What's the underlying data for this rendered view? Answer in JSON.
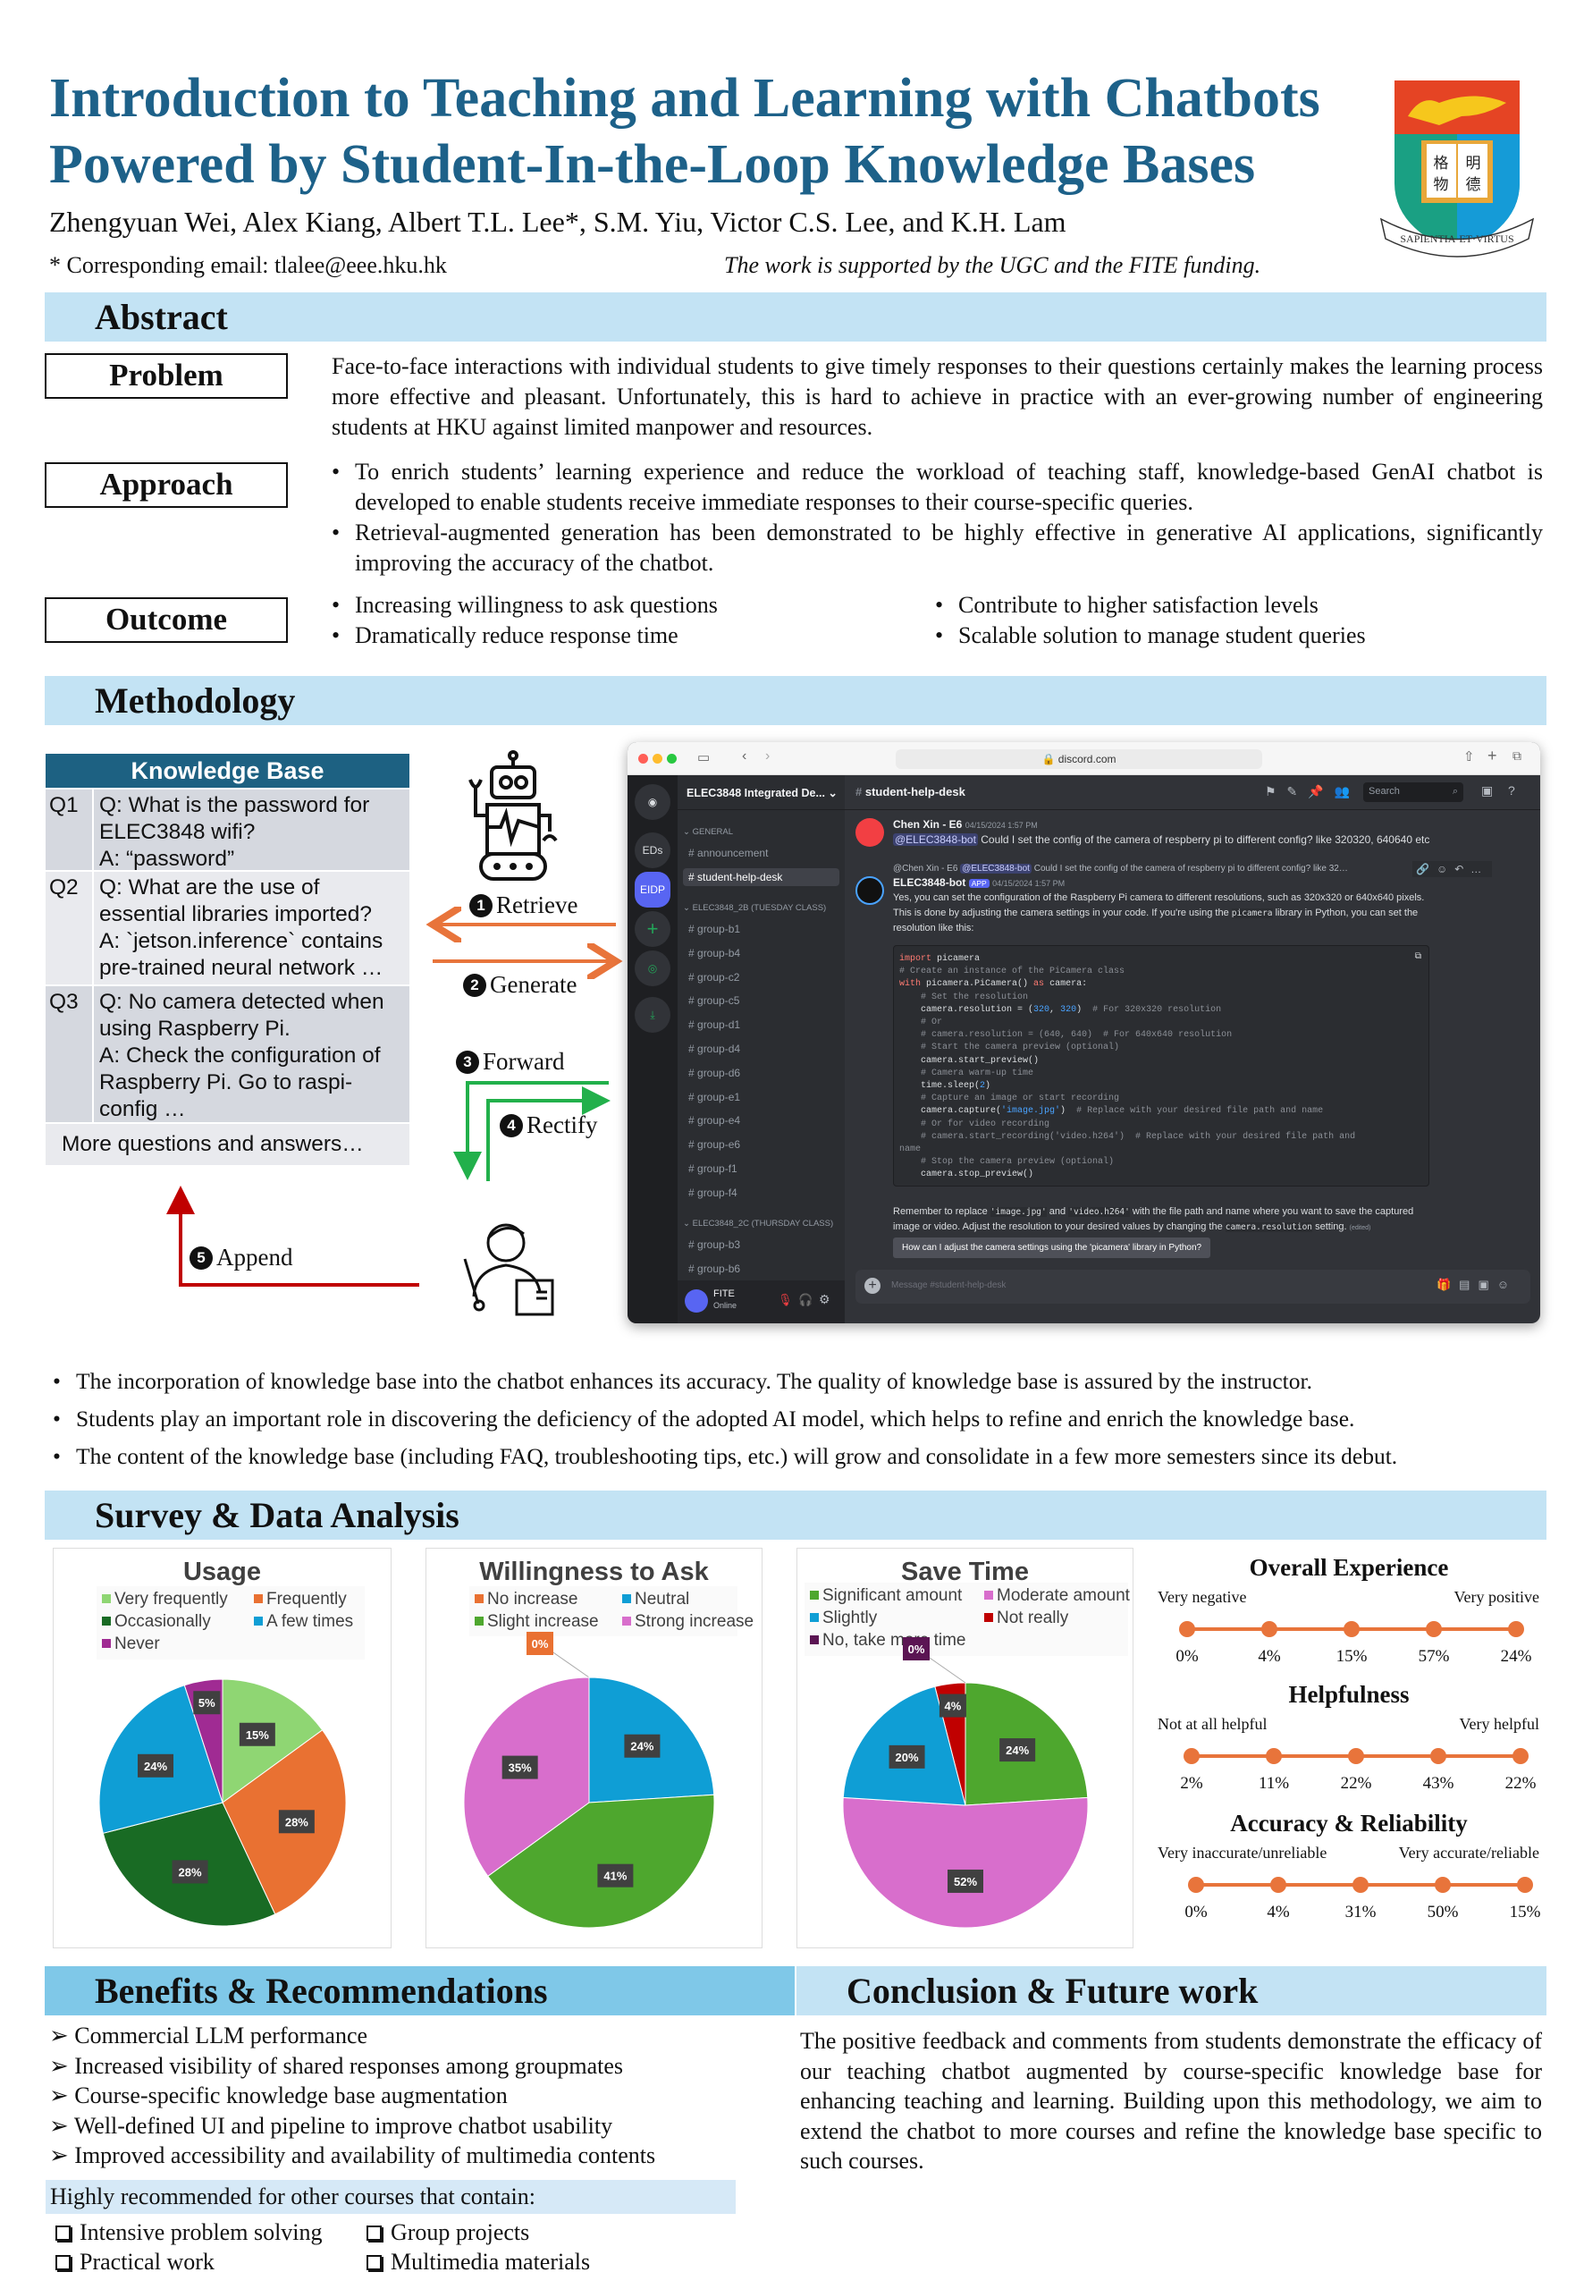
{
  "header": {
    "title_line1": "Introduction to Teaching and Learning with Chatbots",
    "title_line2": "Powered by Student-In-the-Loop Knowledge Bases",
    "authors": "Zhengyuan Wei, Alex Kiang, Albert T.L. Lee*, S.M. Yiu, Victor C.S. Lee, and K.H. Lam",
    "email": "* Corresponding email: tlalee@eee.hku.hk",
    "funding": "The work is supported by the UGC and the FITE funding.",
    "logo": {
      "motto": "SAPIENTIA · ET · VIRTUS",
      "characters": "格物明德"
    }
  },
  "colors": {
    "title": "#1d6189",
    "band": "#c3e3f4",
    "band_dark": "#7fc8e8",
    "kb_header": "#1d6182",
    "scale": "#e8743b"
  },
  "abstract": {
    "heading": "Abstract",
    "problem": {
      "label": "Problem",
      "text": "Face-to-face interactions with individual students to give timely responses to their questions certainly makes the learning process more effective and pleasant. Unfortunately, this is hard to achieve in practice with an ever-growing number of engineering students at HKU against limited manpower and resources."
    },
    "approach": {
      "label": "Approach",
      "bullets": [
        "To enrich students’ learning experience and reduce the workload of teaching staff, knowledge-based GenAI chatbot is developed to enable students receive immediate responses to their course-specific queries.",
        "Retrieval-augmented generation has been demonstrated to be highly effective in generative AI applications, significantly improving the accuracy of the chatbot."
      ]
    },
    "outcome": {
      "label": "Outcome",
      "bullets": [
        "Increasing willingness to ask questions",
        "Dramatically reduce response time",
        "Contribute to higher satisfaction levels",
        "Scalable solution to manage student queries"
      ]
    }
  },
  "methodology": {
    "heading": "Methodology",
    "knowledge_base": {
      "title": "Knowledge Base",
      "rows": [
        {
          "id": "Q1",
          "text": "Q: What is the password for ELEC3848 wifi?\nA: “password”"
        },
        {
          "id": "Q2",
          "text": "Q: What are the use of essential libraries imported?\nA: `jetson.inference` contains pre-trained neural network …"
        },
        {
          "id": "Q3",
          "text": "Q: No camera detected when using Raspberry Pi.\nA: Check the configuration of Raspberry Pi. Go to raspi-config …"
        }
      ],
      "more": "More questions and answers…"
    },
    "steps": [
      {
        "n": "1",
        "label": "Retrieve"
      },
      {
        "n": "2",
        "label": "Generate"
      },
      {
        "n": "3",
        "label": "Forward"
      },
      {
        "n": "4",
        "label": "Rectify"
      },
      {
        "n": "5",
        "label": "Append"
      }
    ],
    "bullets": [
      "The incorporation of knowledge base into the chatbot enhances its accuracy. The quality of knowledge base is assured by the instructor.",
      "Students play an important role in discovering the deficiency of the adopted AI model, which helps to refine and enrich the knowledge base.",
      "The content of the knowledge base (including FAQ, troubleshooting tips, etc.) will grow and consolidate in a few more semesters since its debut."
    ]
  },
  "discord": {
    "url": "discord.com",
    "server_name": "ELEC3848 Integrated De...",
    "servers": [
      "EDs",
      "EIDP"
    ],
    "channel": "student-help-desk",
    "search_placeholder": "Search",
    "categories": [
      "GENERAL",
      "ELEC3848_2B (TUESDAY CLASS)",
      "ELEC3848_2C (THURSDAY CLASS)"
    ],
    "general_channels": [
      "announcement",
      "student-help-desk"
    ],
    "tuesday_channels": [
      "group-b1",
      "group-b4",
      "group-c2",
      "group-c5",
      "group-d1",
      "group-d4",
      "group-d6",
      "group-e1",
      "group-e4",
      "group-e6",
      "group-f1",
      "group-f4"
    ],
    "thursday_channels": [
      "group-b3",
      "group-b6"
    ],
    "user": {
      "name": "FITE",
      "status": "Online"
    },
    "messages": [
      {
        "author": "Chen Xin - E6",
        "time": "04/15/2024 1:57 PM",
        "mention": "@ELEC3848-bot",
        "text": " Could I set the config of the camera of respberry pi to different config? like 320320, 640640 etc"
      },
      {
        "reply_to": "@Chen Xin - E6",
        "reply_mention": "@ELEC3848-bot",
        "reply_text": " Could I set the config of the camera of respberry pi to different config? like 32…",
        "author": "ELEC3848-bot",
        "badge": "APP",
        "time": "04/15/2024 1:57 PM",
        "text1": "Yes, you can set the configuration of the Raspberry Pi camera to different resolutions, such as 320x320 or 640x640 pixels.",
        "text2a": "This is done by adjusting the camera settings in your code. If you're using the ",
        "code_inline": "picamera",
        "text2b": " library in Python, you can set the",
        "text3": "resolution like this:",
        "after1a": "Remember to replace ",
        "after_c1": "'image.jpg'",
        "after1b": " and ",
        "after_c2": "'video.h264'",
        "after1c": " with the file path and name where you want to save the captured",
        "after2a": "image or video. Adjust the resolution to your desired values by changing the ",
        "after_c3": "camera.resolution",
        "after2b": " setting.",
        "edited": "(edited)",
        "suggestion": "How can I adjust the camera settings using the 'picamera' library in Python?"
      }
    ],
    "input_placeholder": "Message #student-help-desk"
  },
  "survey": {
    "heading": "Survey & Data Analysis"
  },
  "chart_data": [
    {
      "type": "pie",
      "title": "Usage",
      "categories": [
        "Very frequently",
        "Frequently",
        "Occasionally",
        "A few times",
        "Never"
      ],
      "values": [
        15,
        28,
        28,
        24,
        5
      ],
      "colors": [
        "#8fd673",
        "#e97132",
        "#196b24",
        "#0f9ed5",
        "#a02b93"
      ],
      "legend": "top"
    },
    {
      "type": "pie",
      "title": "Willingness to Ask",
      "categories": [
        "No increase",
        "Neutral",
        "Slight increase",
        "Strong increase"
      ],
      "values": [
        0,
        24,
        41,
        35
      ],
      "colors": [
        "#e97132",
        "#0f9ed5",
        "#4ea72e",
        "#d86ecc"
      ],
      "legend": "top"
    },
    {
      "type": "pie",
      "title": "Save Time",
      "categories": [
        "Significant amount",
        "Moderate amount",
        "Slightly",
        "Not really",
        "No, take more time"
      ],
      "values": [
        24,
        52,
        20,
        4,
        0
      ],
      "colors": [
        "#4ea72e",
        "#d86ecc",
        "#0f9ed5",
        "#c00000",
        "#5b1553"
      ],
      "legend": "top"
    },
    {
      "type": "scale",
      "title": "Overall Experience",
      "low_label": "Very negative",
      "high_label": "Very positive",
      "values": [
        0,
        4,
        15,
        57,
        24
      ]
    },
    {
      "type": "scale",
      "title": "Helpfulness",
      "low_label": "Not at all helpful",
      "high_label": "Very helpful",
      "values": [
        2,
        11,
        22,
        43,
        22
      ]
    },
    {
      "type": "scale",
      "title": "Accuracy & Reliability",
      "low_label": "Very inaccurate/unreliable",
      "high_label": "Very accurate/reliable",
      "values": [
        0,
        4,
        31,
        50,
        15
      ]
    }
  ],
  "benefits": {
    "heading": "Benefits & Recommendations",
    "items": [
      "Commercial LLM performance",
      "Increased visibility of shared responses among groupmates",
      "Course-specific knowledge base augmentation",
      "Well-defined UI and pipeline to improve chatbot usability",
      "Improved accessibility and availability of multimedia contents"
    ],
    "recommend_heading": "Highly recommended for other courses that contain:",
    "recommend_items": [
      "Intensive problem solving",
      "Group projects",
      "Practical work",
      "Multimedia materials"
    ]
  },
  "conclusion": {
    "heading": "Conclusion & Future work",
    "text": "The positive feedback and comments from students demonstrate the efficacy of our teaching chatbot augmented by course-specific knowledge base for enhancing teaching and learning. Building upon this methodology, we aim to extend the chatbot to more courses and refine the knowledge base specific to such courses."
  }
}
